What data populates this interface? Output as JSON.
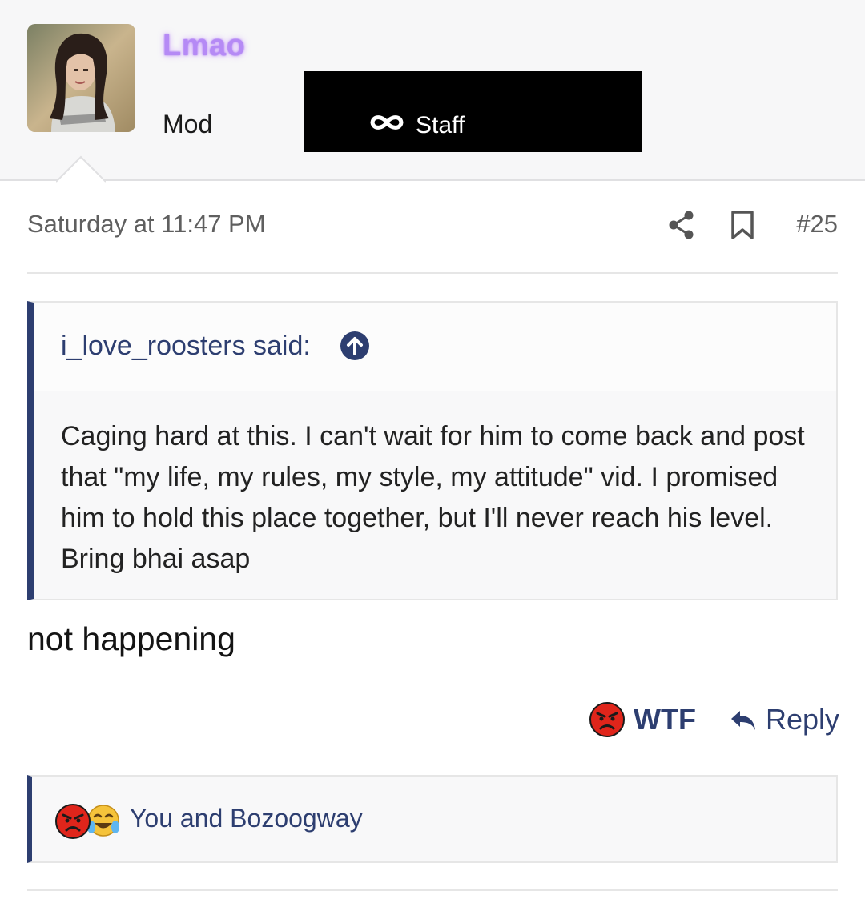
{
  "author": {
    "username": "Lmao",
    "role": "Mod",
    "badge_label": "Staff",
    "badge_icon": "infinity-icon",
    "username_color": "#b58af5"
  },
  "post": {
    "timestamp": "Saturday at 11:47 PM",
    "number": "#25",
    "icons": [
      "share-icon",
      "bookmark-icon"
    ],
    "quote": {
      "author": "i_love_roosters said:",
      "text": "Caging hard at this. I can't wait for him to come back and post that \"my life, my rules, my style, my attitude\" vid. I promised him to hold this place together, but I'll never reach his level. Bring bhai asap"
    },
    "body": "not happening"
  },
  "actions": {
    "reaction_label": "WTF",
    "reaction_icon": "angry-face-icon",
    "reply_label": "Reply",
    "reply_icon": "reply-arrow-icon"
  },
  "reactions_summary": {
    "icons": [
      "angry-face-icon",
      "crying-laughing-face-icon"
    ],
    "text": "You and Bozoogway"
  },
  "colors": {
    "accent": "#2d3e70",
    "muted_text": "#5f5f5f",
    "angry_red": "#e0251b"
  }
}
